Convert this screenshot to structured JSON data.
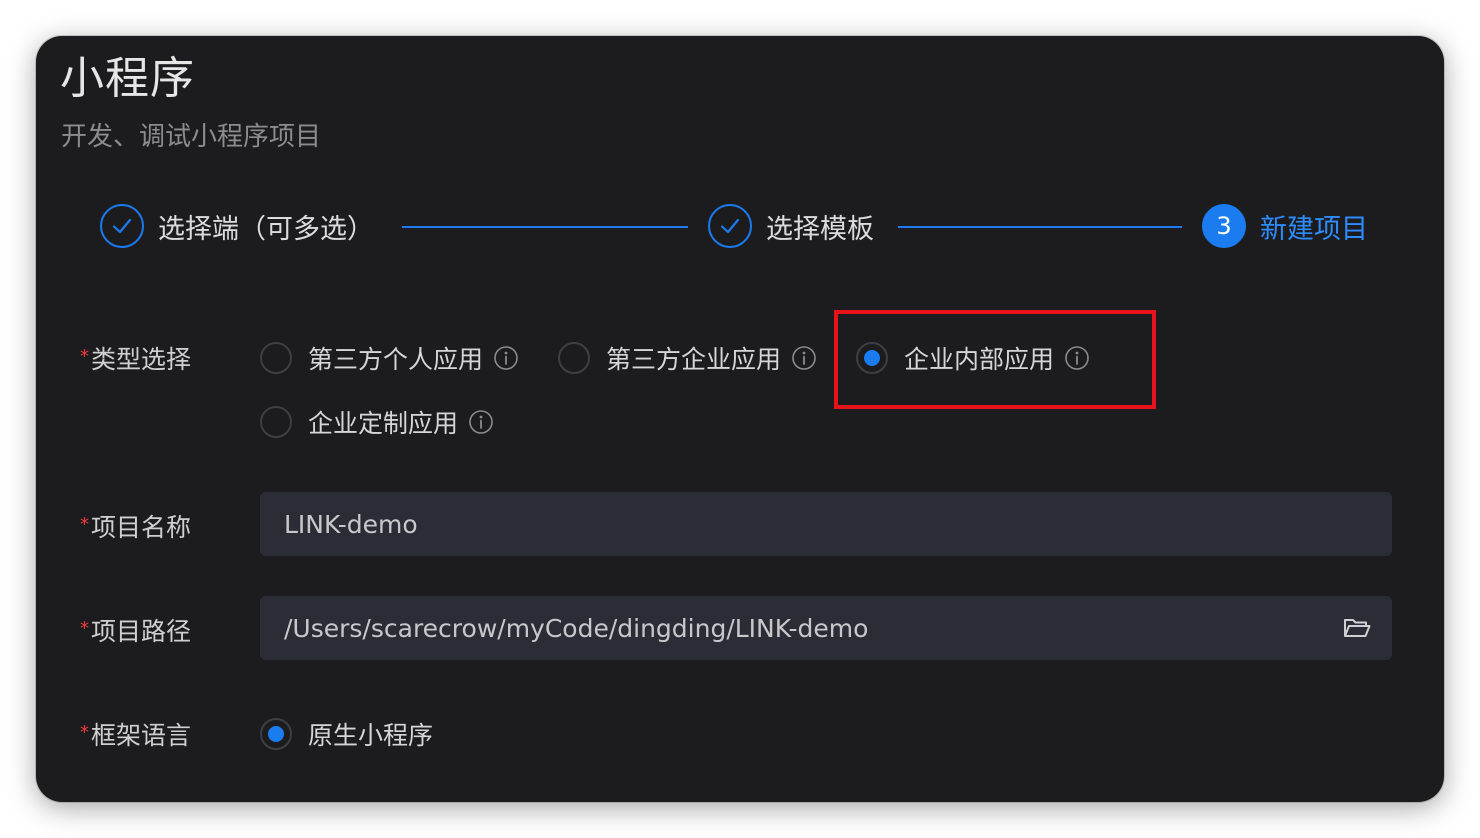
{
  "header": {
    "title": "小程序",
    "subtitle": "开发、调试小程序项目"
  },
  "steps": [
    {
      "label": "选择端（可多选）",
      "status": "done"
    },
    {
      "label": "选择模板",
      "status": "done"
    },
    {
      "label": "新建项目",
      "number": "3",
      "status": "active"
    }
  ],
  "form": {
    "type": {
      "required_mark": "*",
      "label": "类型选择",
      "options": [
        {
          "label": "第三方个人应用",
          "checked": false
        },
        {
          "label": "第三方企业应用",
          "checked": false
        },
        {
          "label": "企业内部应用",
          "checked": true
        },
        {
          "label": "企业定制应用",
          "checked": false
        }
      ]
    },
    "name": {
      "required_mark": "*",
      "label": "项目名称",
      "value": "LINK-demo"
    },
    "path": {
      "required_mark": "*",
      "label": "项目路径",
      "value": "/Users/scarecrow/myCode/dingding/LINK-demo",
      "icon": "folder-open-icon"
    },
    "framework": {
      "required_mark": "*",
      "label": "框架语言",
      "options": [
        {
          "label": "原生小程序",
          "checked": true
        }
      ]
    }
  },
  "colors": {
    "accent": "#1b7cf0",
    "background": "#1c1c1f",
    "input_bg": "#2c2c36",
    "required": "#f23c3c",
    "highlight": "#e8121d"
  }
}
